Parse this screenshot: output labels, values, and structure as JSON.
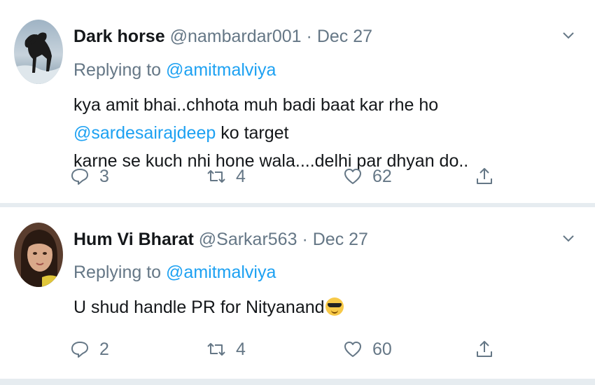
{
  "tweets": [
    {
      "name": "Dark horse",
      "handle": "@nambardar001",
      "separator": "·",
      "date": "Dec 27",
      "replying_prefix": "Replying to",
      "replying_to": "@amitmalviya",
      "text_parts": {
        "a": "kya amit bhai..chhota muh badi baat kar rhe ho ",
        "mention": "@sardesairajdeep",
        "b": "  ko target",
        "line2": "karne se kuch nhi hone wala....delhi par dhyan do.."
      },
      "replies": "3",
      "retweets": "4",
      "likes": "62",
      "avatar_icon": "horse-avatar"
    },
    {
      "name": "Hum Vi Bharat",
      "handle": "@Sarkar563",
      "separator": "·",
      "date": "Dec 27",
      "replying_prefix": "Replying to",
      "replying_to": "@amitmalviya",
      "text_parts": {
        "a": "U shud handle PR for Nityanand"
      },
      "emoji": "sunglasses-emoji",
      "replies": "2",
      "retweets": "4",
      "likes": "60",
      "avatar_icon": "person-avatar"
    }
  ],
  "colors": {
    "text": "#14171a",
    "secondary": "#657786",
    "link": "#1da1f2",
    "divider": "#e6ecf0"
  }
}
